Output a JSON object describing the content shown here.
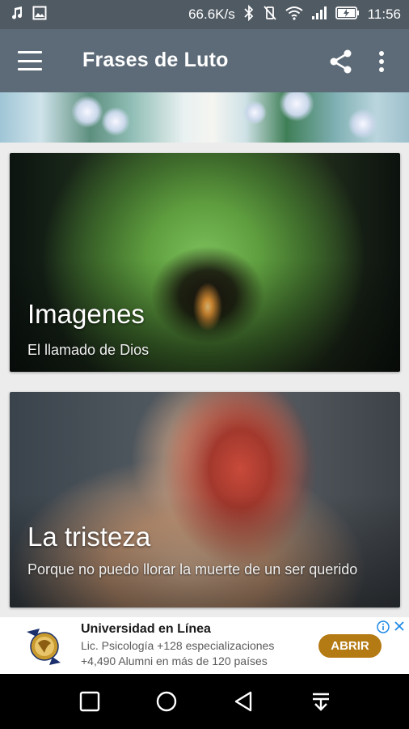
{
  "status_bar": {
    "network_speed": "66.6K/s",
    "time": "11:56",
    "left_icons": [
      "music-icon",
      "image-icon"
    ],
    "right_icons": [
      "bluetooth-icon",
      "vibrate-off-icon",
      "wifi-icon",
      "signal-icon",
      "battery-charging-icon"
    ]
  },
  "app_bar": {
    "title": "Frases de Luto",
    "icons": [
      "menu-icon",
      "share-icon",
      "more-vert-icon"
    ]
  },
  "cards": [
    {
      "title": "Imagenes",
      "subtitle": "El llamado de Dios"
    },
    {
      "title": "La tristeza",
      "subtitle": "Porque no puedo llorar la muerte de un ser querido"
    }
  ],
  "ad": {
    "title": "Universidad en Línea",
    "line1": "Lic. Psicología +128 especializaciones",
    "line2": "+4,490 Alumni en más de 120 países",
    "button_label": "ABRIR",
    "button_color": "#b47a14",
    "accent_icon_color": "#1e88e5"
  },
  "colors": {
    "status_bar": "#505a63",
    "app_bar": "#5d6b78",
    "background": "#ececec"
  },
  "nav_bar": {
    "icons": [
      "recents-square-icon",
      "home-circle-icon",
      "back-triangle-icon",
      "notification-pull-icon"
    ]
  }
}
